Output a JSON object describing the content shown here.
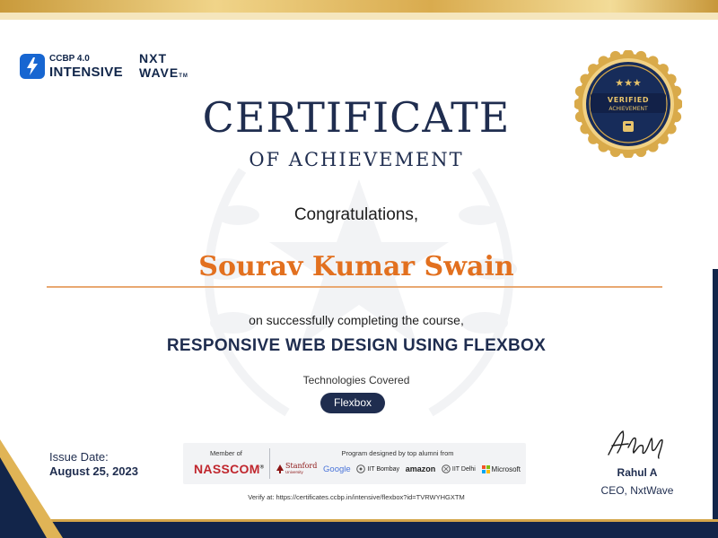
{
  "logos": {
    "ccbp_small": "CCBP 4.0",
    "ccbp_big": "INTENSIVE",
    "nxt_line1": "NXT",
    "nxt_line2": "WAVE",
    "nxt_tm": "TM"
  },
  "badge": {
    "line1": "VERIFIED",
    "line2": "ACHIEVEMENT",
    "stars": "★★★"
  },
  "certificate": {
    "title": "CERTIFICATE",
    "subtitle": "OF ACHIEVEMENT",
    "greeting": "Congratulations,",
    "recipient": "Sourav Kumar Swain",
    "completion_text": "on successfully completing the course,",
    "course": "RESPONSIVE WEB DESIGN USING FLEXBOX",
    "technologies_label": "Technologies Covered",
    "technologies": [
      "Flexbox"
    ]
  },
  "issue": {
    "label": "Issue Date:",
    "date": "August 25, 2023"
  },
  "partners": {
    "member_label": "Member of",
    "member": "NASSCOM",
    "member_reg": "®",
    "program_label": "Program designed by top alumni from",
    "logos": {
      "stanford": "Stanford",
      "stanford_sub": "University",
      "google": "Google",
      "iit_bombay": "IIT Bombay",
      "amazon": "amazon",
      "iit_delhi": "IIT Delhi",
      "microsoft": "Microsoft"
    }
  },
  "verify_text": "Verify at: https://certificates.ccbp.in/intensive/flexbox?id=TVRWYHGXTM",
  "signatory": {
    "name": "Rahul A",
    "role": "CEO, NxtWave"
  },
  "colors": {
    "navy": "#1f2d4f",
    "accent_orange": "#e2701f",
    "gold": "#d4a64a"
  }
}
